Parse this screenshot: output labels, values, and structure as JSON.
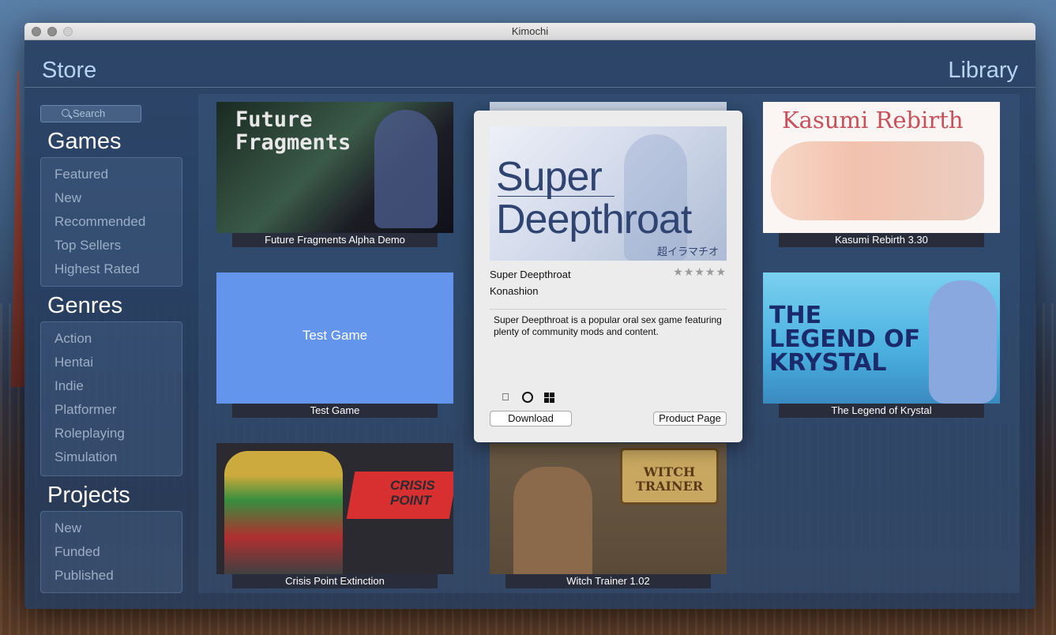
{
  "window": {
    "title": "Kimochi"
  },
  "nav": {
    "store": "Store",
    "library": "Library"
  },
  "search": {
    "placeholder": "Search"
  },
  "sidebar": {
    "games_title": "Games",
    "games": [
      "Featured",
      "New",
      "Recommended",
      "Top Sellers",
      "Highest Rated"
    ],
    "genres_title": "Genres",
    "genres": [
      "Action",
      "Hentai",
      "Indie",
      "Platformer",
      "Roleplaying",
      "Simulation"
    ],
    "projects_title": "Projects",
    "projects": [
      "New",
      "Funded",
      "Published"
    ]
  },
  "games": [
    {
      "label": "Future Fragments Alpha Demo",
      "art_title": "Future Fragments"
    },
    {
      "label": "Kasumi Rebirth 3.30",
      "art_title": "Kasumi Rebirth"
    },
    {
      "label": "Test Game",
      "art_title": "Test Game"
    },
    {
      "label": "The Legend of Krystal",
      "art_title": "THE LEGEND OF KRYSTAL"
    },
    {
      "label": "Crisis Point Extinction",
      "art_title": "CRISIS POINT"
    },
    {
      "label": "Witch Trainer 1.02",
      "art_title": "WITCH TRAINER"
    }
  ],
  "popup": {
    "banner_line1": "Super",
    "banner_line2": "Deepthroat",
    "banner_jp": "超イラマチオ",
    "name": "Super Deepthroat",
    "developer": "Konashion",
    "rating_stars": "★★★★★",
    "description": "Super Deepthroat is a popular oral sex game featuring plenty of community mods and content.",
    "platforms": [
      "apple-icon",
      "ubuntu-icon",
      "windows-icon"
    ],
    "download_label": "Download",
    "product_page_label": "Product Page"
  },
  "colors": {
    "accent_blue": "#6495ed",
    "title_text": "#b8d4f2"
  }
}
